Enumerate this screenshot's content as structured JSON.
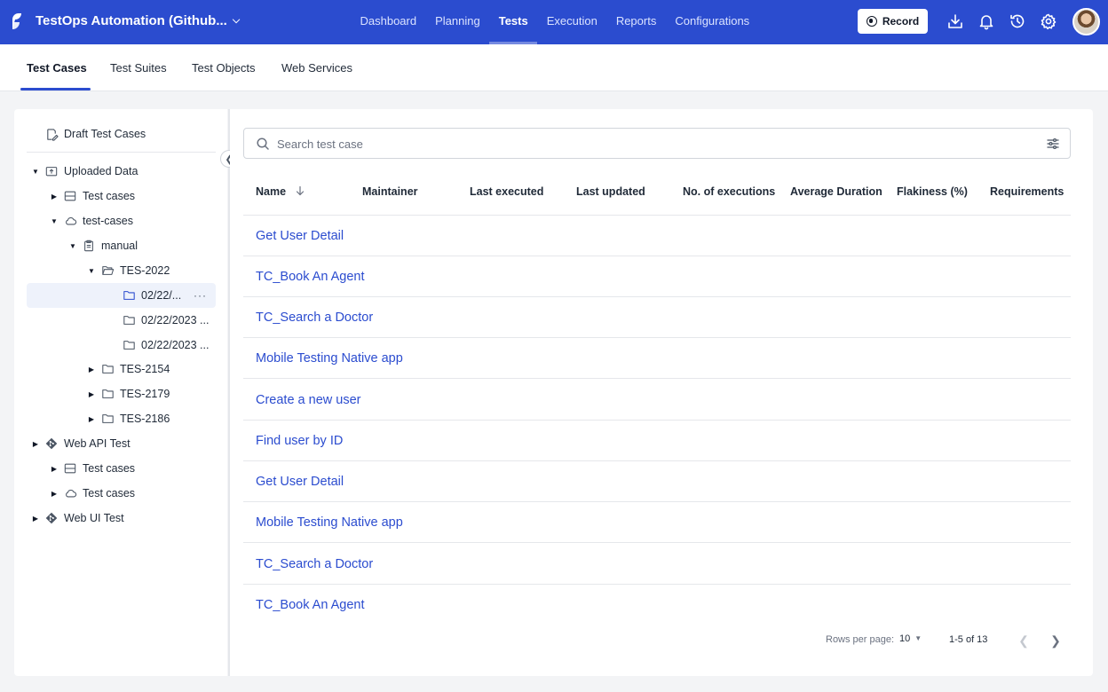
{
  "header": {
    "project_name": "TestOps Automation (Github...",
    "nav": [
      {
        "label": "Dashboard"
      },
      {
        "label": "Planning"
      },
      {
        "label": "Tests"
      },
      {
        "label": "Execution"
      },
      {
        "label": "Reports"
      },
      {
        "label": "Configurations"
      }
    ],
    "active_nav": "Tests",
    "record_label": "Record",
    "icons": [
      "download-icon",
      "bell-icon",
      "history-icon",
      "gear-icon"
    ],
    "accent_color": "#2b4ccf"
  },
  "subtabs": [
    {
      "label": "Test Cases"
    },
    {
      "label": "Test Suites"
    },
    {
      "label": "Test Objects"
    },
    {
      "label": "Web Services"
    }
  ],
  "active_subtab": "Test Cases",
  "tree": {
    "draft": "Draft Test Cases",
    "items": [
      {
        "label": "Uploaded Data",
        "icon": "upload-folder-icon",
        "expanded": true
      },
      {
        "label": "Test cases",
        "icon": "server-icon",
        "expanded": false
      },
      {
        "label": "test-cases",
        "icon": "cloud-icon",
        "expanded": true
      },
      {
        "label": "manual",
        "icon": "clipboard-icon",
        "expanded": true
      },
      {
        "label": "TES-2022",
        "icon": "folder-open-icon",
        "expanded": true
      },
      {
        "label": "02/22/...",
        "icon": "folder-icon",
        "selected": true
      },
      {
        "label": "02/22/2023 ...",
        "icon": "folder-icon"
      },
      {
        "label": "02/22/2023 ...",
        "icon": "folder-icon"
      },
      {
        "label": "TES-2154",
        "icon": "folder-icon",
        "expanded": false
      },
      {
        "label": "TES-2179",
        "icon": "folder-icon",
        "expanded": false
      },
      {
        "label": "TES-2186",
        "icon": "folder-icon",
        "expanded": false
      },
      {
        "label": "Web API Test",
        "icon": "git-icon",
        "expanded": false
      },
      {
        "label": "Test cases",
        "icon": "server-icon",
        "expanded": false
      },
      {
        "label": "Test cases",
        "icon": "cloud-icon",
        "expanded": false
      },
      {
        "label": "Web UI Test",
        "icon": "git-icon",
        "expanded": false
      }
    ],
    "more_label": "···"
  },
  "search": {
    "placeholder": "Search test case",
    "value": ""
  },
  "table": {
    "columns": [
      "Name",
      "Maintainer",
      "Last executed",
      "Last updated",
      "No. of executions",
      "Average Duration",
      "Flakiness (%)",
      "Requirements"
    ],
    "sort": {
      "column": "Name",
      "direction": "desc"
    },
    "rows": [
      {
        "name": "Get User Detail"
      },
      {
        "name": "TC_Book An Agent"
      },
      {
        "name": "TC_Search a Doctor"
      },
      {
        "name": "Mobile Testing Native app"
      },
      {
        "name": "Create a new user"
      },
      {
        "name": "Find user by ID"
      },
      {
        "name": "Get User Detail"
      },
      {
        "name": "Mobile Testing Native app"
      },
      {
        "name": "TC_Search a Doctor"
      },
      {
        "name": "TC_Book An Agent"
      }
    ]
  },
  "pagination": {
    "rows_per_page_label": "Rows per page:",
    "rows_per_page": "10",
    "range": "1-5 of 13"
  }
}
